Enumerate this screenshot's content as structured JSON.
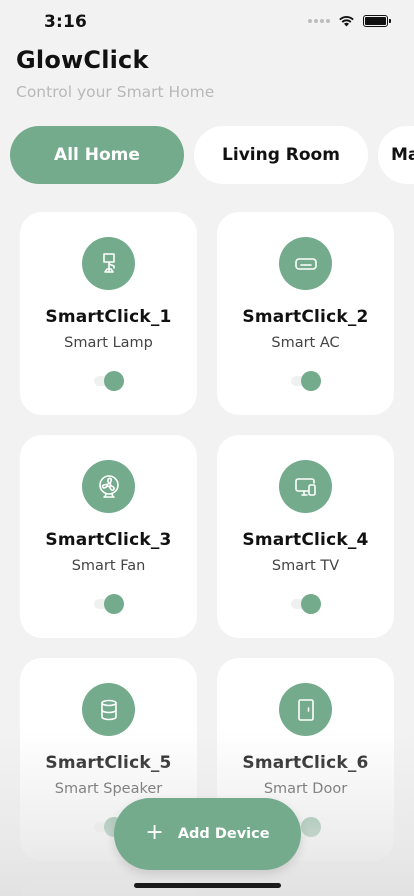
{
  "status_bar": {
    "time": "3:16",
    "icons": [
      "cellular-dots-icon",
      "wifi-icon",
      "battery-icon"
    ]
  },
  "header": {
    "title": "GlowClick",
    "subtitle": "Control your Smart Home"
  },
  "tabs": [
    {
      "label": "All Home",
      "active": true
    },
    {
      "label": "Living Room",
      "active": false
    },
    {
      "label": "Mas",
      "active": false
    }
  ],
  "devices": [
    {
      "name": "SmartClick_1",
      "type": "Smart Lamp",
      "icon": "lamp-icon",
      "on": true
    },
    {
      "name": "SmartClick_2",
      "type": "Smart AC",
      "icon": "air-conditioner-icon",
      "on": true
    },
    {
      "name": "SmartClick_3",
      "type": "Smart Fan",
      "icon": "fan-icon",
      "on": true
    },
    {
      "name": "SmartClick_4",
      "type": "Smart TV",
      "icon": "tv-icon",
      "on": true
    },
    {
      "name": "SmartClick_5",
      "type": "Smart Speaker",
      "icon": "speaker-icon",
      "on": true
    },
    {
      "name": "SmartClick_6",
      "type": "Smart Door",
      "icon": "door-icon",
      "on": true
    }
  ],
  "fab": {
    "label": "Add Device",
    "icon": "plus-icon"
  },
  "colors": {
    "accent": "#74ab8c",
    "background": "#f2f2f2",
    "card": "#ffffff",
    "subtitle": "#b9b9b9"
  }
}
